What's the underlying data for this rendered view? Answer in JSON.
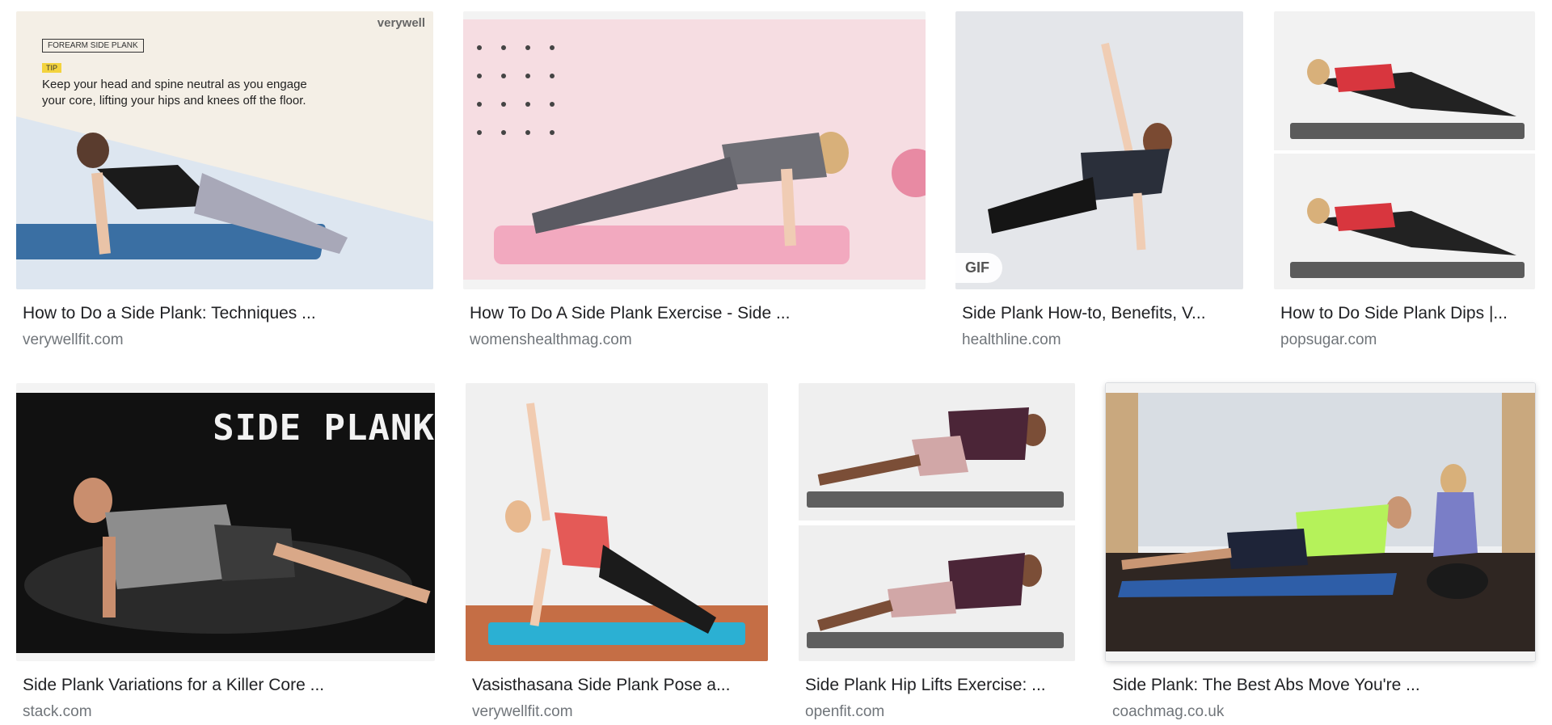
{
  "results": [
    {
      "title": "How to Do a Side Plank: Techniques ...",
      "source": "verywellfit.com",
      "overlay": {
        "brand": "verywell",
        "tag": "FOREARM SIDE PLANK",
        "tip_badge": "TIP",
        "tip_lines": [
          "Keep your head and spine neutral as you engage",
          "your core, lifting your hips and knees off the floor."
        ]
      }
    },
    {
      "title": "How To Do A Side Plank Exercise - Side ...",
      "source": "womenshealthmag.com"
    },
    {
      "title": "Side Plank How-to, Benefits, V...",
      "source": "healthline.com",
      "badge": "GIF"
    },
    {
      "title": "How to Do Side Plank Dips |...",
      "source": "popsugar.com"
    },
    {
      "title": "Side Plank Variations for a Killer Core ...",
      "source": "stack.com",
      "overlay_text": "SIDE PLANK"
    },
    {
      "title": "Vasisthasana Side Plank Pose a...",
      "source": "verywellfit.com"
    },
    {
      "title": "Side Plank Hip Lifts Exercise: ...",
      "source": "openfit.com"
    },
    {
      "title": "Side Plank: The Best Abs Move You're ...",
      "source": "coachmag.co.uk"
    }
  ],
  "colors": {
    "title": "#202124",
    "source": "#70757a",
    "selected_shadow": "#dadce0"
  }
}
